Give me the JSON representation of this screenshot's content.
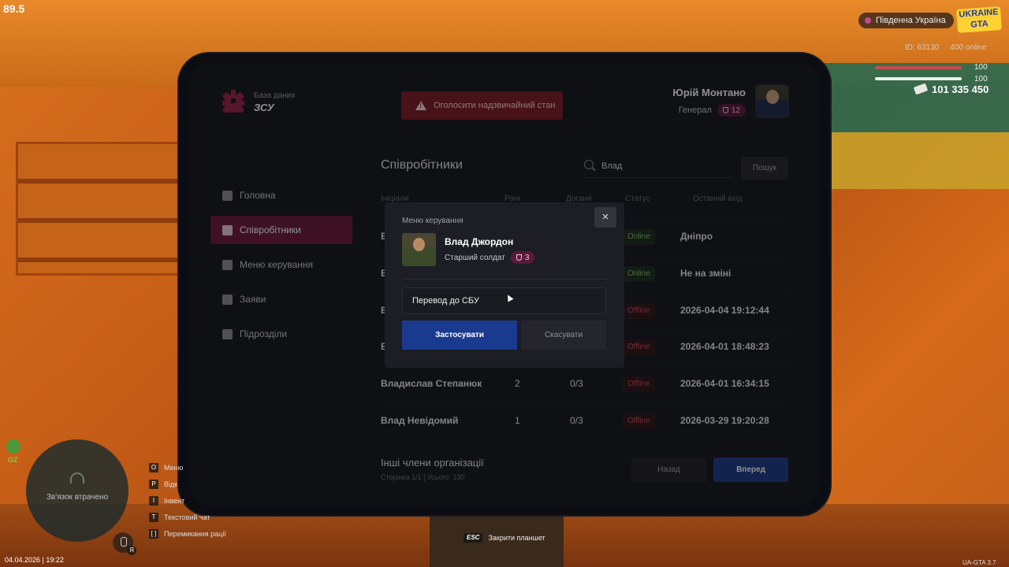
{
  "hud": {
    "fps": "89.5",
    "region": "Південна Україна",
    "logo": "UKRAINE GTA",
    "id_text": "ID: 63130",
    "online_text": "400 online",
    "health": "100",
    "armor": "100",
    "money": "101 335 450",
    "date_time": "04.04.2026 | 19:22",
    "version": "UA-GTA 3.7",
    "gz": "GZ",
    "minimap_status": "Зв'язок втрачено",
    "mic_key": "Я",
    "keys": [
      {
        "key": "O",
        "label": "Меню"
      },
      {
        "key": "P",
        "label": "Відк"
      },
      {
        "key": "I",
        "label": "Інвент"
      },
      {
        "key": "T",
        "label": "Текстовий чат"
      },
      {
        "key": "[ ]",
        "label": "Перемикання рації"
      }
    ],
    "esc_key": "ESC",
    "esc_label": "Закрити планшет"
  },
  "app": {
    "brand_sub": "База даних",
    "brand_title": "ЗСУ",
    "emergency_label": "Оголосити надзвичайний стан",
    "user_name": "Юрій Монтано",
    "user_rank": "Генерал",
    "user_level": "12"
  },
  "nav": {
    "items": [
      {
        "label": "Головна",
        "icon": "home-icon"
      },
      {
        "label": "Співробітники",
        "icon": "people-icon"
      },
      {
        "label": "Меню керування",
        "icon": "gear-icon"
      },
      {
        "label": "Заяви",
        "icon": "folder-icon"
      },
      {
        "label": "Підрозділи",
        "icon": "shield-icon"
      }
    ]
  },
  "main": {
    "title": "Співробітники",
    "search_value": "Влад",
    "search_button": "Пошук",
    "headers": [
      "Ініціали",
      "Ранг",
      "Догани",
      "Статус",
      "Останній вхід"
    ],
    "rows": [
      {
        "name": "В",
        "rank": "",
        "warns": "",
        "status": "Online",
        "last": "Дніпро"
      },
      {
        "name": "В",
        "rank": "",
        "warns": "",
        "status": "Online",
        "last": "Не на зміні"
      },
      {
        "name": "В",
        "rank": "",
        "warns": "",
        "status": "Offline",
        "last": "2026-04-04 19:12:44"
      },
      {
        "name": "В",
        "rank": "",
        "warns": "",
        "status": "Offline",
        "last": "2026-04-01 18:48:23"
      },
      {
        "name": "Владислав Степанюк",
        "rank": "2",
        "warns": "0/3",
        "status": "Offline",
        "last": "2026-04-01 16:34:15"
      },
      {
        "name": "Влад Невідомий",
        "rank": "1",
        "warns": "0/3",
        "status": "Offline",
        "last": "2026-03-29 19:20:28"
      }
    ],
    "others_title": "Інші члени організації",
    "page_info": "Сторінка 1/1 | Усього: 130",
    "back": "Назад",
    "forward": "Вперед"
  },
  "modal": {
    "title": "Меню керування",
    "name": "Влад Джордон",
    "rank": "Старший солдат",
    "level": "3",
    "action": "Перевод до СБУ",
    "apply": "Застосувати",
    "cancel": "Скасувати",
    "close": "×"
  },
  "colors": {
    "accent": "#6b1a3a",
    "primary_button": "#1a3a86",
    "online": "#7fbf6a",
    "offline": "#c4485a",
    "emergency": "#7a1a24"
  }
}
